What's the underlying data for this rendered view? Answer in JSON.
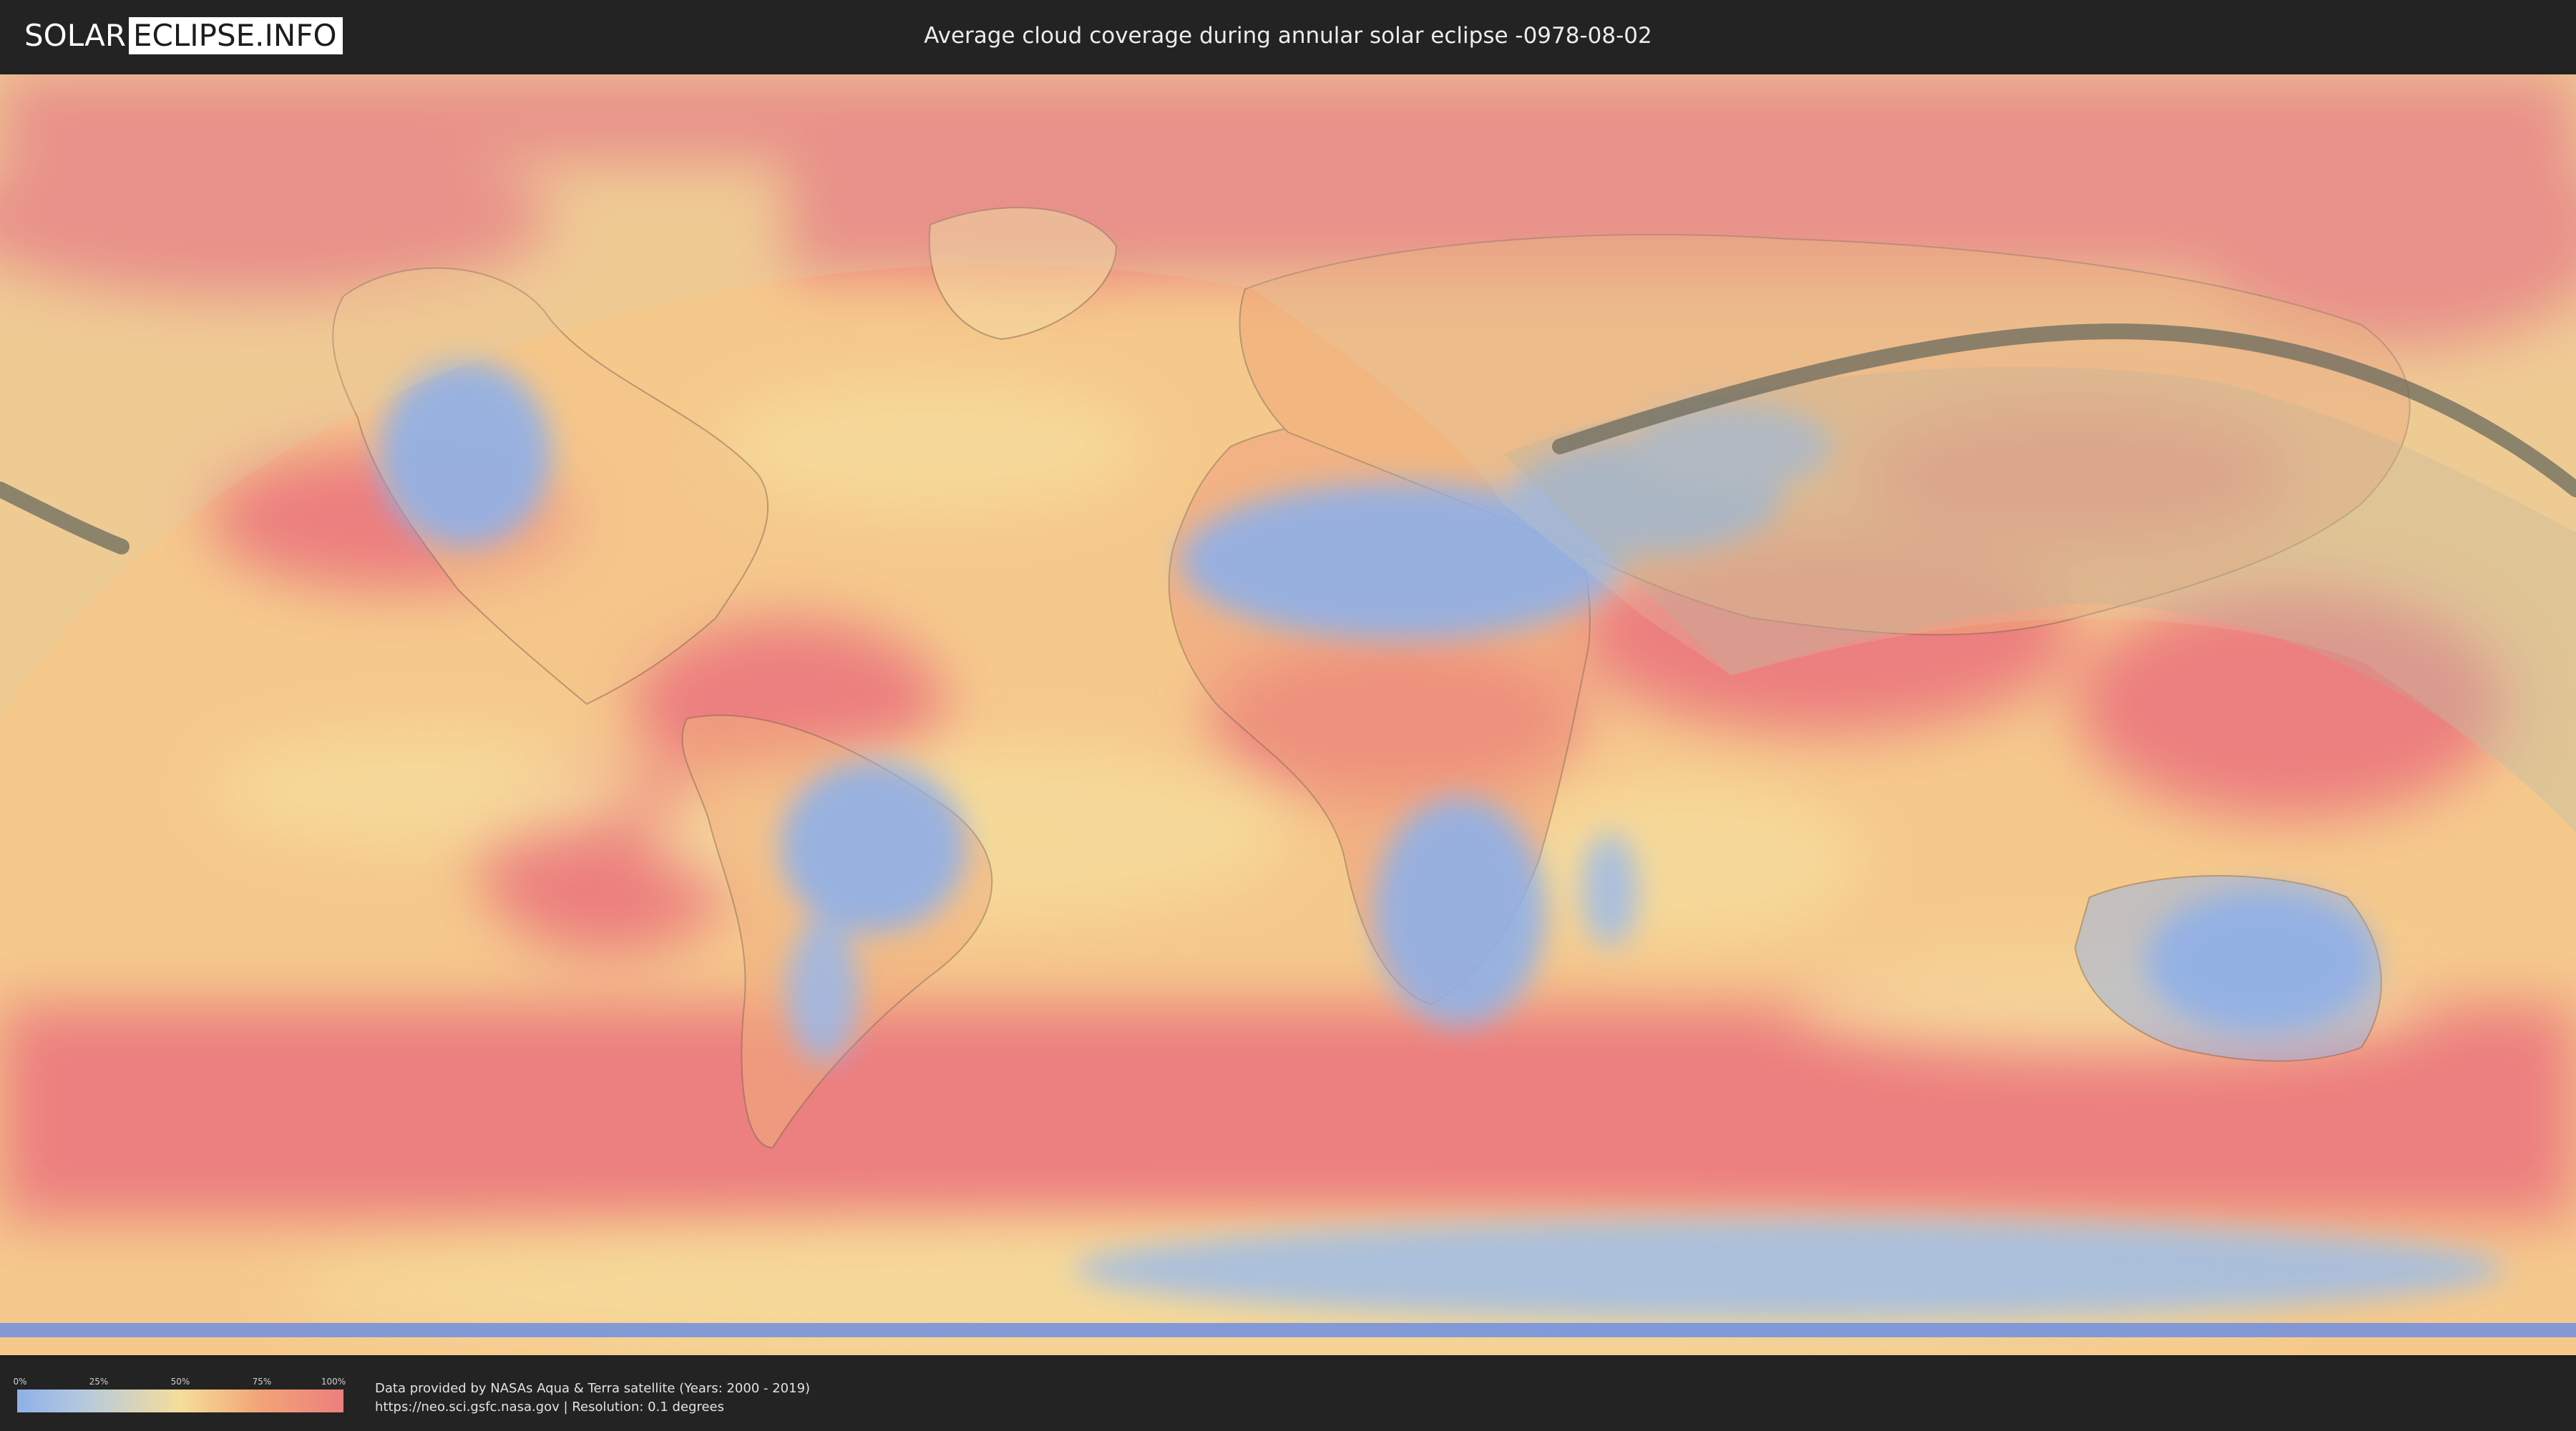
{
  "header": {
    "logo_left": "SOLAR",
    "logo_right": "ECLIPSE.INFO",
    "title": "Average cloud coverage during annular solar eclipse -0978-08-02"
  },
  "legend": {
    "ticks": [
      "0%",
      "25%",
      "50%",
      "75%",
      "100%"
    ],
    "colors": [
      "#8fb0e8",
      "#b4c9df",
      "#f5dd9a",
      "#f2a376",
      "#ec7f7f"
    ]
  },
  "footer": {
    "credit_line1": "Data provided by NASAs Aqua & Terra satellite (Years: 2000 - 2019)",
    "credit_line2": "https://neo.sci.gsfc.nasa.gov | Resolution: 0.1 degrees"
  },
  "map": {
    "ocean_base_color": "#f5c98c",
    "cloudy_color": "#ec7f7f",
    "clear_color": "#8fb0e8",
    "eclipse_path_color": "#6b6b5e"
  }
}
